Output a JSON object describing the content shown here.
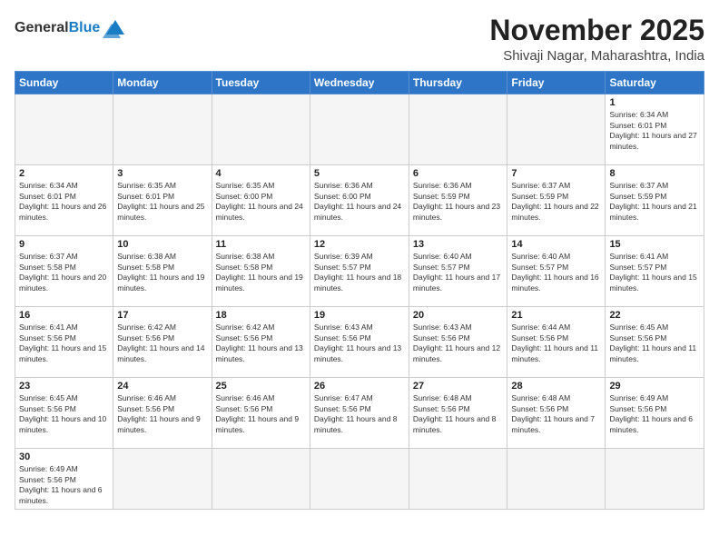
{
  "header": {
    "logo": {
      "general": "General",
      "blue": "Blue"
    },
    "month": "November 2025",
    "location": "Shivaji Nagar, Maharashtra, India"
  },
  "weekdays": [
    "Sunday",
    "Monday",
    "Tuesday",
    "Wednesday",
    "Thursday",
    "Friday",
    "Saturday"
  ],
  "weeks": [
    [
      {
        "day": null
      },
      {
        "day": null
      },
      {
        "day": null
      },
      {
        "day": null
      },
      {
        "day": null
      },
      {
        "day": null
      },
      {
        "day": 1,
        "sunrise": "6:34 AM",
        "sunset": "6:01 PM",
        "daylight": "11 hours and 27 minutes."
      }
    ],
    [
      {
        "day": 2,
        "sunrise": "6:34 AM",
        "sunset": "6:01 PM",
        "daylight": "11 hours and 26 minutes."
      },
      {
        "day": 3,
        "sunrise": "6:35 AM",
        "sunset": "6:01 PM",
        "daylight": "11 hours and 25 minutes."
      },
      {
        "day": 4,
        "sunrise": "6:35 AM",
        "sunset": "6:00 PM",
        "daylight": "11 hours and 24 minutes."
      },
      {
        "day": 5,
        "sunrise": "6:36 AM",
        "sunset": "6:00 PM",
        "daylight": "11 hours and 24 minutes."
      },
      {
        "day": 6,
        "sunrise": "6:36 AM",
        "sunset": "5:59 PM",
        "daylight": "11 hours and 23 minutes."
      },
      {
        "day": 7,
        "sunrise": "6:37 AM",
        "sunset": "5:59 PM",
        "daylight": "11 hours and 22 minutes."
      },
      {
        "day": 8,
        "sunrise": "6:37 AM",
        "sunset": "5:59 PM",
        "daylight": "11 hours and 21 minutes."
      }
    ],
    [
      {
        "day": 9,
        "sunrise": "6:37 AM",
        "sunset": "5:58 PM",
        "daylight": "11 hours and 20 minutes."
      },
      {
        "day": 10,
        "sunrise": "6:38 AM",
        "sunset": "5:58 PM",
        "daylight": "11 hours and 19 minutes."
      },
      {
        "day": 11,
        "sunrise": "6:38 AM",
        "sunset": "5:58 PM",
        "daylight": "11 hours and 19 minutes."
      },
      {
        "day": 12,
        "sunrise": "6:39 AM",
        "sunset": "5:57 PM",
        "daylight": "11 hours and 18 minutes."
      },
      {
        "day": 13,
        "sunrise": "6:40 AM",
        "sunset": "5:57 PM",
        "daylight": "11 hours and 17 minutes."
      },
      {
        "day": 14,
        "sunrise": "6:40 AM",
        "sunset": "5:57 PM",
        "daylight": "11 hours and 16 minutes."
      },
      {
        "day": 15,
        "sunrise": "6:41 AM",
        "sunset": "5:57 PM",
        "daylight": "11 hours and 15 minutes."
      }
    ],
    [
      {
        "day": 16,
        "sunrise": "6:41 AM",
        "sunset": "5:56 PM",
        "daylight": "11 hours and 15 minutes."
      },
      {
        "day": 17,
        "sunrise": "6:42 AM",
        "sunset": "5:56 PM",
        "daylight": "11 hours and 14 minutes."
      },
      {
        "day": 18,
        "sunrise": "6:42 AM",
        "sunset": "5:56 PM",
        "daylight": "11 hours and 13 minutes."
      },
      {
        "day": 19,
        "sunrise": "6:43 AM",
        "sunset": "5:56 PM",
        "daylight": "11 hours and 13 minutes."
      },
      {
        "day": 20,
        "sunrise": "6:43 AM",
        "sunset": "5:56 PM",
        "daylight": "11 hours and 12 minutes."
      },
      {
        "day": 21,
        "sunrise": "6:44 AM",
        "sunset": "5:56 PM",
        "daylight": "11 hours and 11 minutes."
      },
      {
        "day": 22,
        "sunrise": "6:45 AM",
        "sunset": "5:56 PM",
        "daylight": "11 hours and 11 minutes."
      }
    ],
    [
      {
        "day": 23,
        "sunrise": "6:45 AM",
        "sunset": "5:56 PM",
        "daylight": "11 hours and 10 minutes."
      },
      {
        "day": 24,
        "sunrise": "6:46 AM",
        "sunset": "5:56 PM",
        "daylight": "11 hours and 9 minutes."
      },
      {
        "day": 25,
        "sunrise": "6:46 AM",
        "sunset": "5:56 PM",
        "daylight": "11 hours and 9 minutes."
      },
      {
        "day": 26,
        "sunrise": "6:47 AM",
        "sunset": "5:56 PM",
        "daylight": "11 hours and 8 minutes."
      },
      {
        "day": 27,
        "sunrise": "6:48 AM",
        "sunset": "5:56 PM",
        "daylight": "11 hours and 8 minutes."
      },
      {
        "day": 28,
        "sunrise": "6:48 AM",
        "sunset": "5:56 PM",
        "daylight": "11 hours and 7 minutes."
      },
      {
        "day": 29,
        "sunrise": "6:49 AM",
        "sunset": "5:56 PM",
        "daylight": "11 hours and 6 minutes."
      }
    ],
    [
      {
        "day": 30,
        "sunrise": "6:49 AM",
        "sunset": "5:56 PM",
        "daylight": "11 hours and 6 minutes."
      },
      {
        "day": null
      },
      {
        "day": null
      },
      {
        "day": null
      },
      {
        "day": null
      },
      {
        "day": null
      },
      {
        "day": null
      }
    ]
  ]
}
